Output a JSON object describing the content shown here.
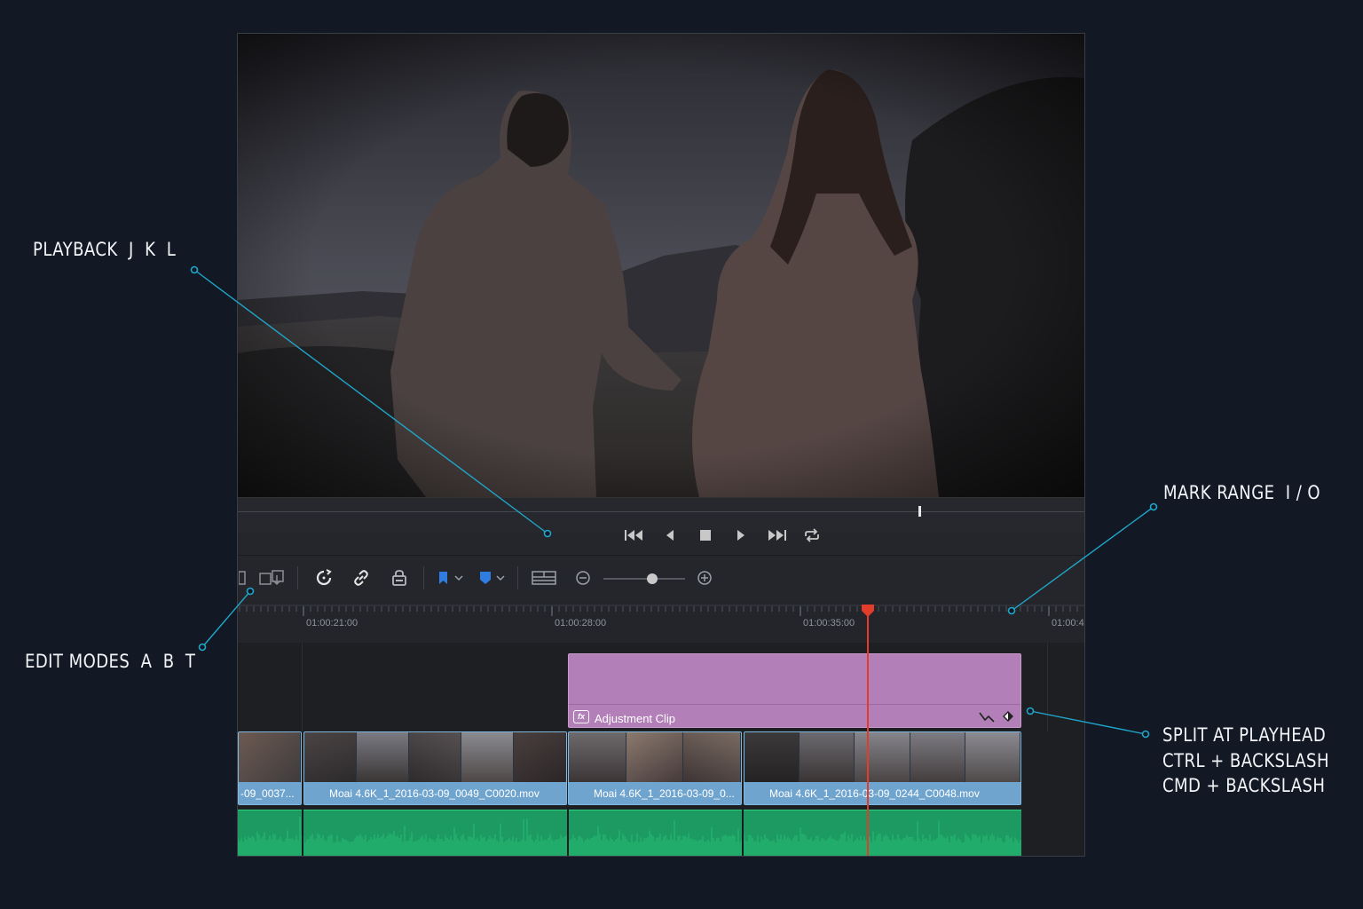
{
  "annotations": {
    "playback": "PLAYBACK  J  K  L",
    "mark_range": "MARK RANGE  I / O",
    "edit_modes": "EDIT MODES  A  B  T",
    "split": "SPLIT AT PLAYHEAD\nCTRL + BACKSLASH\nCMD + BACKSLASH"
  },
  "colors": {
    "background": "#121824",
    "leader_line": "#1fa6c9",
    "adjustment_clip": "#b37fb8",
    "video_clip": "#6fa4cf",
    "audio_clip": "#1d9a62",
    "playhead": "#e23c2a"
  },
  "transport": {
    "buttons": [
      "skip-to-start-icon",
      "play-reverse-icon",
      "stop-icon",
      "play-icon",
      "skip-to-end-icon",
      "loop-icon"
    ]
  },
  "toolbar": {
    "tools": [
      "trim-edit-mode-icon",
      "dynamic-trim-icon",
      "snapping-icon",
      "linked-selection-icon",
      "position-lock-icon",
      "flag-icon",
      "marker-icon",
      "timeline-view-options-icon",
      "zoom-out-icon",
      "zoom-in-icon"
    ],
    "zoom_level": 0.6
  },
  "timeline": {
    "timecodes": [
      "01:00:21:00",
      "01:00:28:00",
      "01:00:35:00",
      "01:00:4"
    ],
    "adjustment_clip": {
      "label": "Adjustment Clip"
    },
    "video_clips": [
      "-09_0037...",
      "Moai 4.6K_1_2016-03-09_0049_C0020.mov",
      "Moai 4.6K_1_2016-03-09_0...",
      "Moai 4.6K_1_2016-03-09_0244_C0048.mov"
    ]
  }
}
